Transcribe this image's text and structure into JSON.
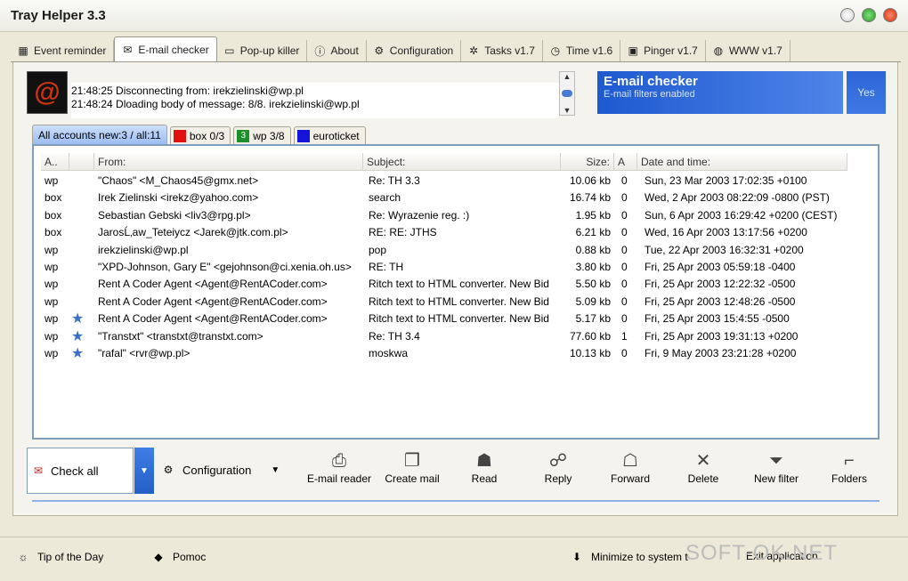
{
  "window": {
    "title": "Tray Helper  3.3"
  },
  "tabs": [
    {
      "label": "Event reminder",
      "icon": "calendar-icon"
    },
    {
      "label": "E-mail checker",
      "icon": "mail-icon"
    },
    {
      "label": "Pop-up killer",
      "icon": "window-icon"
    },
    {
      "label": "About",
      "icon": "info-icon"
    },
    {
      "label": "Configuration",
      "icon": "config-icon"
    },
    {
      "label": "Tasks v1.7",
      "icon": "gear-icon"
    },
    {
      "label": "Time v1.6",
      "icon": "clock-icon"
    },
    {
      "label": "Pinger v1.7",
      "icon": "computer-icon"
    },
    {
      "label": "WWW v1.7",
      "icon": "globe-icon"
    }
  ],
  "status": {
    "lines": [
      "21:48:25  Disconnecting from:    irekzielinski@wp.pl",
      "21:48:24  Dloading body of message: 8/8.    irekzielinski@wp.pl"
    ]
  },
  "info": {
    "title": "E-mail checker",
    "subtitle": "E-mail filters enabled",
    "yes": "Yes"
  },
  "accounts": [
    {
      "label": "All accounts  new:3 / all:11",
      "swatch": ""
    },
    {
      "label": "box  0/3",
      "swatch": "#e01010",
      "swatch_text": ""
    },
    {
      "label": "wp  3/8",
      "swatch": "#1a8f2a",
      "swatch_text": "3"
    },
    {
      "label": "euroticket",
      "swatch": "#1414d8",
      "swatch_text": ""
    }
  ],
  "columns": [
    "A..",
    "From:",
    "Subject:",
    "Size:",
    "A",
    "Date and time:"
  ],
  "messages": [
    {
      "acct": "wp",
      "star": false,
      "from": "\"Chaos\" <M_Chaos45@gmx.net>",
      "subject": "Re: TH 3.3",
      "size": "10.06 kb",
      "a": "0",
      "date": "Sun, 23 Mar 2003 17:02:35 +0100"
    },
    {
      "acct": "box",
      "star": false,
      "from": "Irek Zielinski <irekz@yahoo.com>",
      "subject": "search",
      "size": "16.74 kb",
      "a": "0",
      "date": "Wed, 2 Apr 2003 08:22:09 -0800 (PST)"
    },
    {
      "acct": "box",
      "star": false,
      "from": "Sebastian Gebski <liv3@rpg.pl>",
      "subject": "Re: Wyrazenie reg. :)",
      "size": "1.95 kb",
      "a": "0",
      "date": "Sun, 6 Apr 2003 16:29:42 +0200 (CEST)"
    },
    {
      "acct": "box",
      "star": false,
      "from": "JarosĹ‚aw_Teteiycz <Jarek@jtk.com.pl>",
      "subject": "RE: RE: JTHS",
      "size": "6.21 kb",
      "a": "0",
      "date": "Wed, 16 Apr 2003 13:17:56 +0200"
    },
    {
      "acct": "wp",
      "star": false,
      "from": "irekzielinski@wp.pl",
      "subject": "pop",
      "size": "0.88 kb",
      "a": "0",
      "date": "Tue, 22 Apr 2003 16:32:31 +0200"
    },
    {
      "acct": "wp",
      "star": false,
      "from": "\"XPD-Johnson, Gary E\" <gejohnson@ci.xenia.oh.us>",
      "subject": "RE: TH",
      "size": "3.80 kb",
      "a": "0",
      "date": "Fri, 25 Apr 2003 05:59:18 -0400"
    },
    {
      "acct": "wp",
      "star": false,
      "from": "Rent A Coder Agent <Agent@RentACoder.com>",
      "subject": "Ritch text to HTML converter. New Bid",
      "size": "5.50 kb",
      "a": "0",
      "date": "Fri, 25 Apr 2003 12:22:32 -0500"
    },
    {
      "acct": "wp",
      "star": false,
      "from": "Rent A Coder Agent <Agent@RentACoder.com>",
      "subject": "Ritch text to HTML converter. New Bid",
      "size": "5.09 kb",
      "a": "0",
      "date": "Fri, 25 Apr 2003 12:48:26 -0500"
    },
    {
      "acct": "wp",
      "star": true,
      "from": "Rent A Coder Agent <Agent@RentACoder.com>",
      "subject": "Ritch text to HTML converter. New Bid",
      "size": "5.17 kb",
      "a": "0",
      "date": "Fri, 25 Apr 2003 15:4:55 -0500"
    },
    {
      "acct": "wp",
      "star": true,
      "from": "\"Transtxt\" <transtxt@transtxt.com>",
      "subject": "Re: TH 3.4",
      "size": "77.60 kb",
      "a": "1",
      "date": "Fri, 25 Apr 2003 19:31:13 +0200"
    },
    {
      "acct": "wp",
      "star": true,
      "from": "\"rafal\" <rvr@wp.pl>",
      "subject": "moskwa",
      "size": "10.13 kb",
      "a": "0",
      "date": "Fri, 9 May 2003 23:21:28 +0200"
    }
  ],
  "toolbar": {
    "check_all": "Check all",
    "configuration": "Configuration",
    "buttons": [
      {
        "label": "E-mail reader",
        "icon": "reader-icon"
      },
      {
        "label": "Create mail",
        "icon": "create-mail-icon"
      },
      {
        "label": "Read",
        "icon": "read-icon"
      },
      {
        "label": "Reply",
        "icon": "reply-icon"
      },
      {
        "label": "Forward",
        "icon": "forward-icon"
      },
      {
        "label": "Delete",
        "icon": "delete-icon"
      },
      {
        "label": "New filter",
        "icon": "filter-icon"
      },
      {
        "label": "Folders",
        "icon": "folder-icon"
      }
    ]
  },
  "bottom": {
    "tip": "Tip of the Day",
    "help": "Pomoc",
    "minimize": "Minimize to system t",
    "exit": "Exit application",
    "watermark": "SOFT-OK.NET"
  }
}
